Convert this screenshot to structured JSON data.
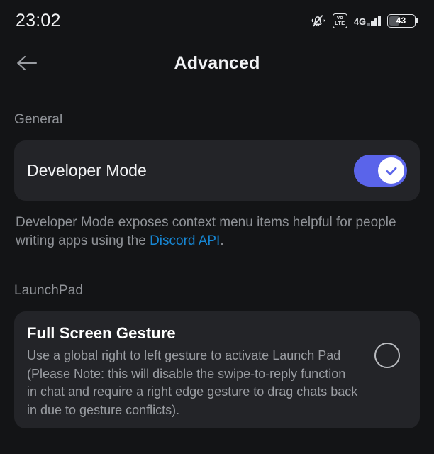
{
  "status_bar": {
    "time": "23:02",
    "icons": [
      {
        "name": "bell-muted-icon",
        "label": "silent"
      },
      {
        "name": "volte-icon",
        "line1": "Vo",
        "line2": "LTE"
      },
      {
        "name": "network-4g-icon",
        "label": "4G"
      },
      {
        "name": "signal-bars-icon",
        "label": "signal"
      }
    ],
    "battery": {
      "percent": "43",
      "name": "battery-icon"
    }
  },
  "header": {
    "title": "Advanced",
    "back_icon": "arrow-left-icon"
  },
  "sections": [
    {
      "label": "General",
      "rows": [
        {
          "label": "Developer Mode",
          "control": "switch",
          "state": "on"
        }
      ],
      "description": {
        "before": "Developer Mode exposes context menu items helpful for people writing apps using the ",
        "link": "Discord API",
        "after": "."
      }
    },
    {
      "label": "LaunchPad",
      "card": {
        "title": "Full Screen Gesture",
        "body": "Use a global right to left gesture to activate Launch Pad (Please Note: this will disable the swipe-to-reply function in chat and require a right edge gesture to drag chats back in due to gesture conflicts).",
        "control": "radio",
        "state": "off"
      }
    }
  ],
  "colors": {
    "background": "#131416",
    "card": "#232428",
    "accent_blurple": "#5a64ea",
    "link_blue": "#1787d4",
    "text_primary": "#f2f3f5",
    "text_muted": "#8f9297"
  }
}
